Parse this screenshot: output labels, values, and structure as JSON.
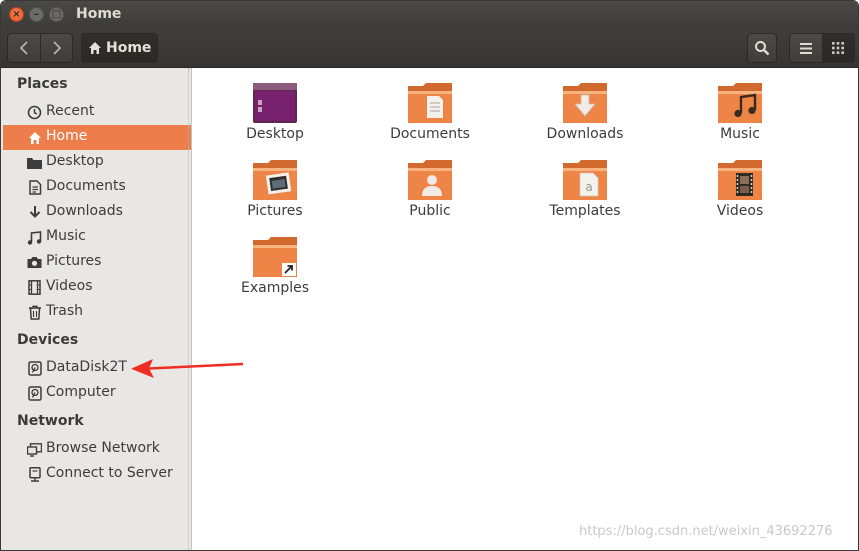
{
  "window": {
    "title": "Home",
    "controls": {
      "close": "×",
      "minimize": "–",
      "maximize": "□"
    }
  },
  "toolbar": {
    "back_icon": "chevron-left-icon",
    "forward_icon": "chevron-right-icon",
    "path_label": "Home",
    "search_icon": "search-icon",
    "view_list_icon": "list-view-icon",
    "view_grid_icon": "grid-view-icon"
  },
  "sidebar": {
    "places_heading": "Places",
    "places": [
      {
        "label": "Recent",
        "icon": "clock-icon"
      },
      {
        "label": "Home",
        "icon": "home-icon",
        "active": true
      },
      {
        "label": "Desktop",
        "icon": "desktop-folder-icon"
      },
      {
        "label": "Documents",
        "icon": "document-icon"
      },
      {
        "label": "Downloads",
        "icon": "download-icon"
      },
      {
        "label": "Music",
        "icon": "music-icon"
      },
      {
        "label": "Pictures",
        "icon": "camera-icon"
      },
      {
        "label": "Videos",
        "icon": "film-icon"
      },
      {
        "label": "Trash",
        "icon": "trash-icon"
      }
    ],
    "devices_heading": "Devices",
    "devices": [
      {
        "label": "DataDisk2T",
        "icon": "drive-icon"
      },
      {
        "label": "Computer",
        "icon": "drive-icon"
      }
    ],
    "network_heading": "Network",
    "network": [
      {
        "label": "Browse Network",
        "icon": "network-icon"
      },
      {
        "label": "Connect to Server",
        "icon": "server-icon"
      }
    ]
  },
  "main": {
    "folders": [
      {
        "label": "Desktop",
        "icon": "desktop-folder-icon"
      },
      {
        "label": "Documents",
        "icon": "documents-folder-icon"
      },
      {
        "label": "Downloads",
        "icon": "downloads-folder-icon"
      },
      {
        "label": "Music",
        "icon": "music-folder-icon"
      },
      {
        "label": "Pictures",
        "icon": "pictures-folder-icon"
      },
      {
        "label": "Public",
        "icon": "public-folder-icon"
      },
      {
        "label": "Templates",
        "icon": "templates-folder-icon"
      },
      {
        "label": "Videos",
        "icon": "videos-folder-icon"
      },
      {
        "label": "Examples",
        "icon": "examples-folder-icon"
      }
    ]
  },
  "colors": {
    "accent": "#ed7d4b",
    "titlebar": "#3c3b37",
    "sidebar_bg": "#e8e7e4",
    "annotation_arrow": "#ee2e24"
  },
  "watermark": "https://blog.csdn.net/weixin_43692276"
}
